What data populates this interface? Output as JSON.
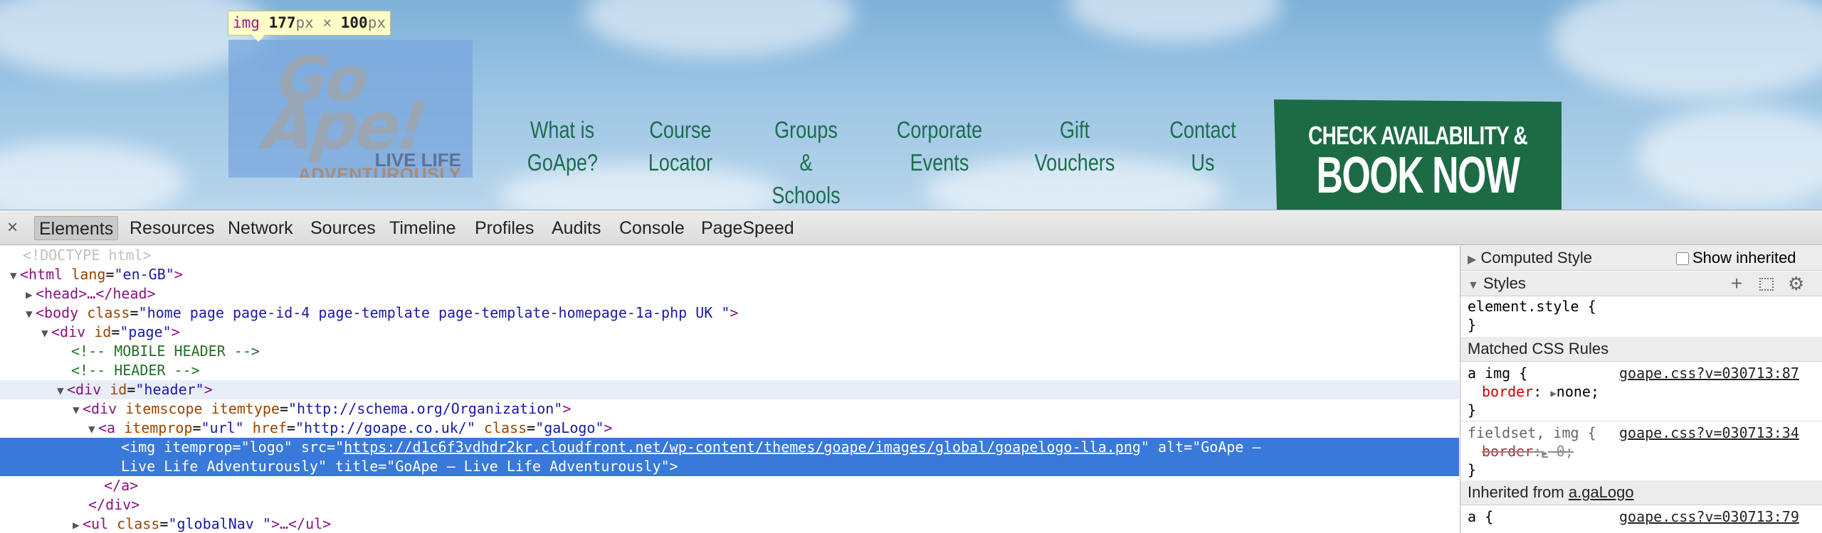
{
  "tooltip": {
    "tag": "img",
    "width": "177",
    "height": "100",
    "unit": "px",
    "sep": " × "
  },
  "logo": {
    "line1": "Go",
    "line2": "Ape!",
    "line3": "LIVE LIFE",
    "line4": "ADVENTUROUSLY"
  },
  "nav": [
    {
      "line1": "What is",
      "line2": "GoApe?"
    },
    {
      "line1": "Course",
      "line2": "Locator"
    },
    {
      "line1": "Groups &",
      "line2": "Schools"
    },
    {
      "line1": "Corporate",
      "line2": "Events"
    },
    {
      "line1": "Gift",
      "line2": "Vouchers"
    },
    {
      "line1": "Contact",
      "line2": "Us"
    }
  ],
  "book": {
    "line1": "CHECK AVAILABILITY &",
    "line2": "BOOK NOW"
  },
  "devtools": {
    "close": "×",
    "tabs": [
      "Elements",
      "Resources",
      "Network",
      "Sources",
      "Timeline",
      "Profiles",
      "Audits",
      "Console",
      "PageSpeed"
    ]
  },
  "dom": {
    "doctype": "<!DOCTYPE html>",
    "html_open": "<html",
    "html_attr": "lang",
    "html_val": "\"en-GB\"",
    "head": "<head>…</head>",
    "body_open": "<body",
    "body_attr": "class",
    "body_val": "\"home page page-id-4 page-template page-template-homepage-1a-php UK  \"",
    "div_page_attr": "id",
    "div_page_val": "\"page\"",
    "comment1": "<!-- MOBILE HEADER -->",
    "comment2": "<!-- HEADER -->",
    "div_header_val": "\"header\"",
    "div_scope_attr1": "itemscope",
    "div_scope_attr2": "itemtype",
    "div_scope_val": "\"http://schema.org/Organization\"",
    "a_attr1": "itemprop",
    "a_val1": "\"url\"",
    "a_attr2": "href",
    "a_val2": "\"http://goape.co.uk/\"",
    "a_attr3": "class",
    "a_val3": "\"gaLogo\"",
    "img_attr1": "itemprop",
    "img_val1": "\"logo\"",
    "img_attr2": "src",
    "img_src": "https://d1c6f3vdhdr2kr.cloudfront.net/wp-content/themes/goape/images/global/goapelogo-lla.png",
    "img_attr3": "alt",
    "img_alt_a": "\"GoApe –",
    "img_alt_b": "Live Life Adventurously\"",
    "img_attr4": "title",
    "img_title": "\"GoApe – Live Life Adventurously\"",
    "a_close": "</a>",
    "div_close": "</div>",
    "ul_attr": "class",
    "ul_val": "\"globalNav \"",
    "ul_rest": ">…</ul>"
  },
  "sidebar": {
    "computed": "Computed Style",
    "show_inherited": "Show inherited",
    "styles": "Styles",
    "element_style": "element.style {",
    "brace": "}",
    "matched": "Matched CSS Rules",
    "rule1_sel": "a img {",
    "rule1_src": "goape.css?v=030713:87",
    "rule1_prop": "border",
    "rule1_val": "none;",
    "rule2_sel": "fieldset, img {",
    "rule2_src": "goape.css?v=030713:34",
    "rule2_prop": "border",
    "rule2_val": "0;",
    "inherited_from": "Inherited from",
    "inherited_link": "a.gaLogo",
    "rule3_sel": "a {",
    "rule3_src": "goape.css?v=030713:79"
  }
}
